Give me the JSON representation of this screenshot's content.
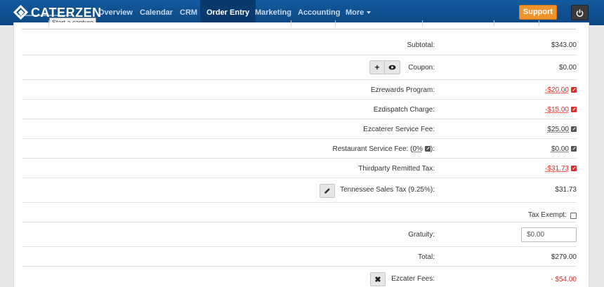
{
  "nav": {
    "brand": "CATERZEN",
    "items": [
      {
        "label": "Overview"
      },
      {
        "label": "Calendar"
      },
      {
        "label": "CRM"
      },
      {
        "label": "Order Entry"
      },
      {
        "label": "Marketing"
      },
      {
        "label": "Accounting"
      },
      {
        "label": "More"
      }
    ],
    "support_label": "Support",
    "tooltip": "Start a capture",
    "active_item": "Order Entry",
    "colors": {
      "navbar": "#0d4e8f",
      "support": "#f0932a",
      "negative": "#d9302c"
    },
    "icons": {
      "power": "power-icon",
      "more": "caret-down-icon"
    }
  },
  "totals": {
    "subtotal": {
      "label": "Subtotal:",
      "value": "$343.00"
    },
    "coupon": {
      "label": "Coupon:",
      "value": "$0.00"
    },
    "ezrewards": {
      "label": "Ezrewards Program:",
      "value": "-$20.00"
    },
    "ezdispatch": {
      "label": "Ezdispatch Charge:",
      "value": "-$15.00"
    },
    "ezcaterer_fee": {
      "label": "Ezcaterer Service Fee:",
      "value": "$25.00"
    },
    "restaurant_fee": {
      "label_prefix": "Restaurant Service Fee: (",
      "label_pct": "0%",
      "label_suffix": "):",
      "value": "$0.00"
    },
    "thirdparty_tax": {
      "label": "Thirdparty Remitted Tax:",
      "value": "-$31.73"
    },
    "sales_tax": {
      "label": "Tennessee Sales Tax (9.25%):",
      "value": "$31.73"
    },
    "tax_exempt": {
      "label": "Tax Exempt:",
      "checked": false
    },
    "gratuity": {
      "label": "Gratuity:",
      "placeholder": "$0.00"
    },
    "total": {
      "label": "Total:",
      "value": "$279.00"
    },
    "ezcater_fees": {
      "label": "Ezcater Fees:",
      "value": "- $54.00"
    }
  }
}
